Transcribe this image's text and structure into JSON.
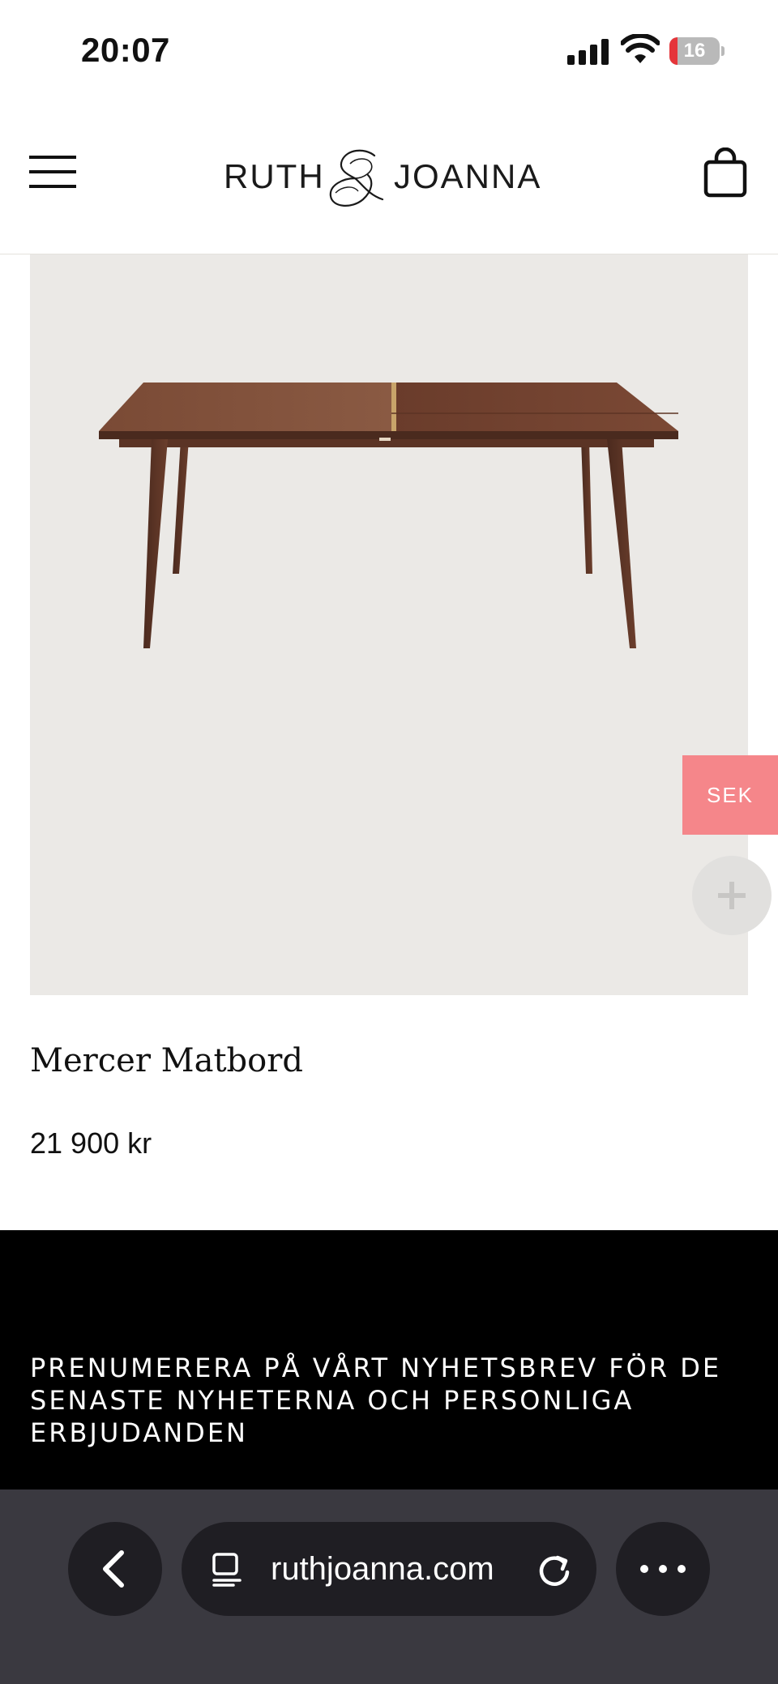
{
  "status_bar": {
    "time": "20:07",
    "battery_level": "16",
    "icons": [
      "signal-icon",
      "wifi-icon",
      "battery-icon"
    ]
  },
  "header": {
    "logo_left": "RUTH",
    "logo_right": "JOANNA",
    "icons": [
      "menu-icon",
      "ampersand-logo-icon",
      "shopping-bag-icon"
    ]
  },
  "product": {
    "title": "Mercer Matbord",
    "price": "21 900 kr",
    "image": "walnut-dining-table"
  },
  "floating": {
    "currency_label": "SEK",
    "plus_icon": "plus-icon"
  },
  "newsletter": {
    "text": "PRENUMERERA PÅ VÅRT NYHETSBREV FÖR DE SENASTE NYHETERNA OCH PERSONLIGA ERBJUDANDEN"
  },
  "browser": {
    "url": "ruthjoanna.com",
    "icons": [
      "back-chevron-icon",
      "page-icon",
      "reload-icon",
      "more-icon"
    ]
  },
  "colors": {
    "accent_pink": "#f5868a",
    "image_background": "#ebe9e6",
    "newsletter_background": "#000000",
    "browser_bar": "#3a3940"
  }
}
